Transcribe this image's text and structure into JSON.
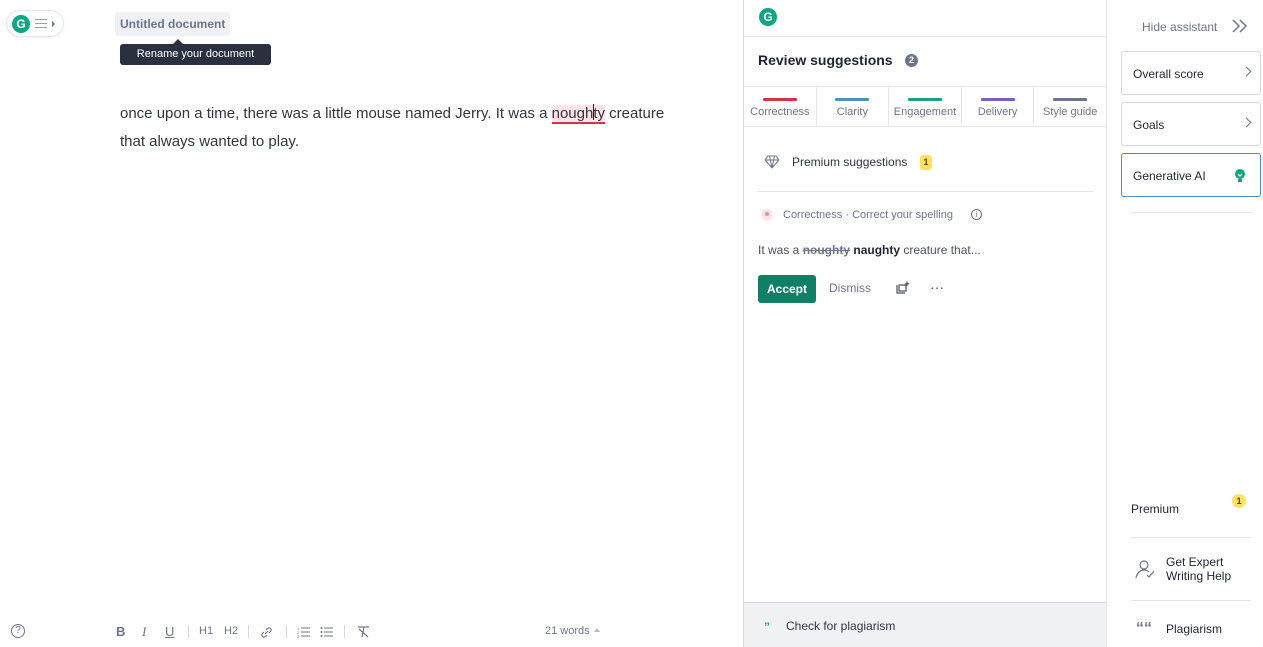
{
  "editor": {
    "document_title": "Untitled document",
    "tooltip": "Rename your document",
    "text_before": "once upon a time, there was a little mouse named Jerry. It was a ",
    "error_word_a": "nough",
    "error_word_b": "ty",
    "text_after": " creature that always wanted to play.",
    "word_count": "21 words",
    "toolbar": {
      "bold": "B",
      "italic": "I",
      "underline": "U",
      "h1": "H1",
      "h2": "H2",
      "link_icon": "link-icon",
      "ordered_list_icon": "ordered-list-icon",
      "bullet_list_icon": "bullet-list-icon",
      "clear_format_icon": "clear-format-icon"
    },
    "help": "?"
  },
  "assistant": {
    "logo": "G",
    "review_title": "Review suggestions",
    "review_count": "2",
    "categories": [
      {
        "label": "Correctness",
        "color": "#d3334b"
      },
      {
        "label": "Clarity",
        "color": "#4a8fbf"
      },
      {
        "label": "Engagement",
        "color": "#11a683"
      },
      {
        "label": "Delivery",
        "color": "#7d5cc4"
      },
      {
        "label": "Style guide",
        "color": "#6d758d"
      }
    ],
    "premium": {
      "label": "Premium suggestions",
      "count": "1"
    },
    "card": {
      "category": "Correctness · Correct your spelling",
      "info": "i",
      "sentence_prefix": "It was a ",
      "wrong": "noughty",
      "right": "naughty",
      "sentence_suffix": " creature that...",
      "accept": "Accept",
      "dismiss": "Dismiss",
      "more": "···"
    },
    "plagiarism": {
      "quote": "”",
      "label": "Check for plagiarism"
    }
  },
  "sidebar": {
    "hide_label": "Hide assistant",
    "cards": [
      {
        "label": "Overall score"
      },
      {
        "label": "Goals"
      },
      {
        "label": "Generative AI"
      }
    ],
    "premium": {
      "label": "Premium",
      "count": "1"
    },
    "expert": "Get Expert Writing Help",
    "plagiarism": "Plagiarism",
    "plagiarism_icon": "““"
  },
  "colors": {
    "brand": "#11a683",
    "accept": "#0f7f66",
    "error": "#d3334b",
    "badge": "#ffe166"
  }
}
